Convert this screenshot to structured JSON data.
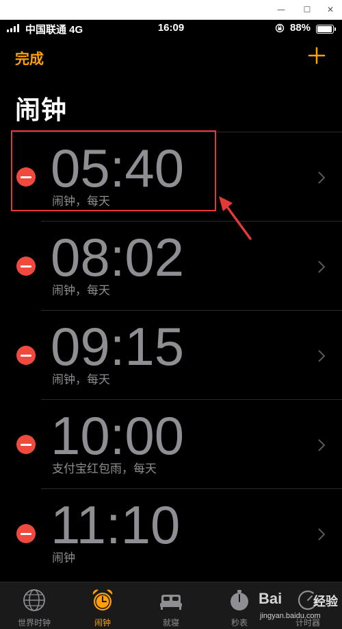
{
  "window_controls": {
    "minimize": "—",
    "maximize": "☐",
    "close": "✕"
  },
  "status_bar": {
    "carrier": "中国联通  4G",
    "time": "16:09",
    "battery_percent": "88%",
    "battery_level": 0.88
  },
  "nav": {
    "done_label": "完成",
    "add_icon": "plus-icon"
  },
  "page_title": "闹钟",
  "alarms": [
    {
      "time": "05:40",
      "label": "闹钟，每天"
    },
    {
      "time": "08:02",
      "label": "闹钟，每天"
    },
    {
      "time": "09:15",
      "label": "闹钟，每天"
    },
    {
      "time": "10:00",
      "label": "支付宝红包雨，每天"
    },
    {
      "time": "11:10",
      "label": "闹钟"
    }
  ],
  "tabs": [
    {
      "label": "世界时钟",
      "icon": "globe-icon",
      "active": false
    },
    {
      "label": "闹钟",
      "icon": "alarm-clock-icon",
      "active": true
    },
    {
      "label": "就寝",
      "icon": "bed-icon",
      "active": false
    },
    {
      "label": "秒表",
      "icon": "stopwatch-icon",
      "active": false
    },
    {
      "label": "计时器",
      "icon": "timer-icon",
      "active": false
    }
  ],
  "watermark": {
    "logo": "Bai",
    "brand": "经验",
    "url": "jingyan.baidu.com"
  },
  "colors": {
    "accent": "#ff9f0a",
    "delete": "#ef4a3d",
    "annotation": "#e53935",
    "muted_text": "#8e8e93"
  }
}
